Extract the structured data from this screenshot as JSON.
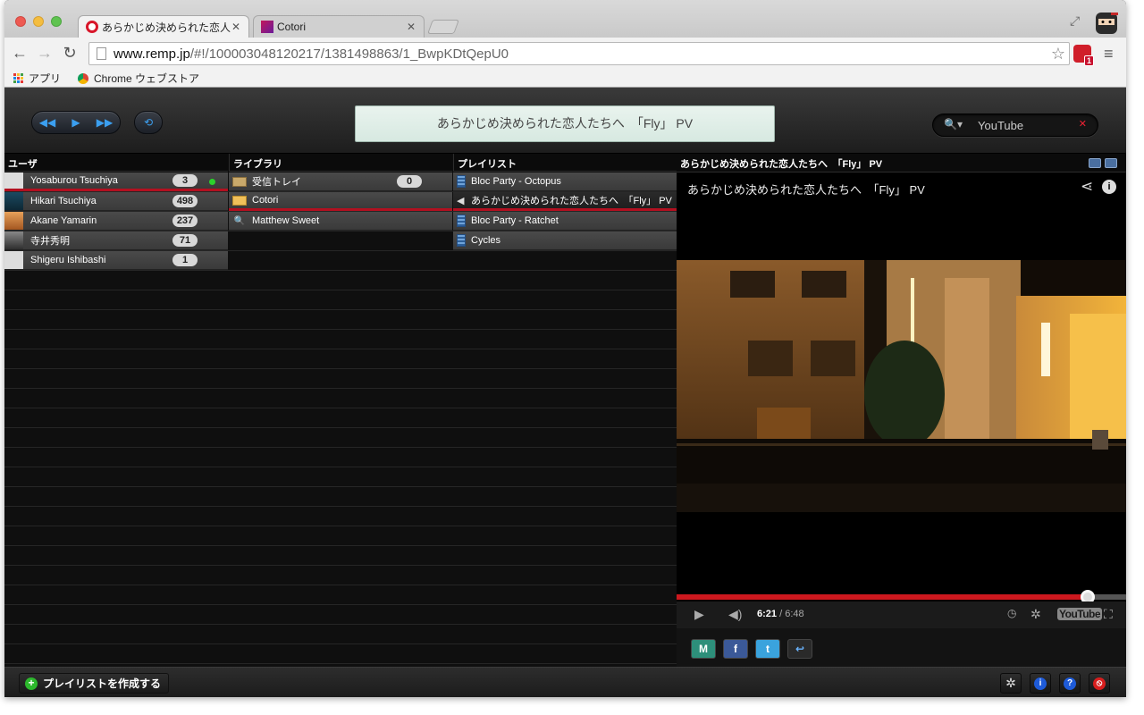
{
  "browser": {
    "tabs": [
      {
        "title": "あらかじめ決められた恋人たちへ",
        "active": true
      },
      {
        "title": "Cotori",
        "active": false
      }
    ],
    "url_host": "www.remp.jp",
    "url_path": "/#!/100003048120217/1381498863/1_BwpKDtQepU0",
    "extension_badge": "1",
    "bookmarks": [
      "アプリ",
      "Chrome ウェブストア"
    ]
  },
  "header": {
    "now_playing": "あらかじめ決められた恋人たちへ　「Fly」 PV",
    "search_value": "YouTube"
  },
  "columns": {
    "users_header": "ユーザ",
    "library_header": "ライブラリ",
    "playlist_header": "プレイリスト",
    "video_header": "あらかじめ決められた恋人たちへ　「Fly」 PV"
  },
  "users": [
    {
      "name": "Yosaburou Tsuchiya",
      "count": "3",
      "online": true,
      "selected": true
    },
    {
      "name": "Hikari Tsuchiya",
      "count": "498",
      "online": false,
      "selected": false
    },
    {
      "name": "Akane Yamarin",
      "count": "237",
      "online": false,
      "selected": false
    },
    {
      "name": "寺井秀明",
      "count": "71",
      "online": false,
      "selected": false
    },
    {
      "name": "Shigeru Ishibashi",
      "count": "1",
      "online": false,
      "selected": false
    }
  ],
  "library": [
    {
      "name": "受信トレイ",
      "count": "0",
      "icon": "inbox-icon",
      "selected": false
    },
    {
      "name": "Cotori",
      "count": "",
      "icon": "folder-icon",
      "selected": true
    },
    {
      "name": "Matthew Sweet",
      "count": "",
      "icon": "search-icon",
      "selected": false
    }
  ],
  "playlist": [
    {
      "name": "Bloc Party - Octopus",
      "icon": "film-icon",
      "playing": false
    },
    {
      "name": "あらかじめ決められた恋人たちへ　「Fly」 PV",
      "icon": "speaker-icon",
      "playing": true
    },
    {
      "name": "Bloc Party - Ratchet",
      "icon": "film-icon",
      "playing": false
    },
    {
      "name": "Cycles",
      "icon": "film-icon",
      "playing": false
    }
  ],
  "player": {
    "title": "あらかじめ決められた恋人たちへ　「Fly」 PV",
    "current_time": "6:21",
    "duration": "6:48",
    "progress_fraction": 0.915,
    "logo": "YouTube"
  },
  "share_buttons": [
    "mixi-icon",
    "facebook-icon",
    "twitter-icon",
    "reply-icon"
  ],
  "footer": {
    "create_playlist_label": "プレイリストを作成する",
    "buttons": [
      "settings-icon",
      "info-icon",
      "help-icon",
      "block-icon"
    ]
  },
  "colors": {
    "accent_blue": "#3b9ff0",
    "selection_red": "#b31020",
    "progress_red": "#cc181e",
    "online_green": "#2bd12b"
  }
}
